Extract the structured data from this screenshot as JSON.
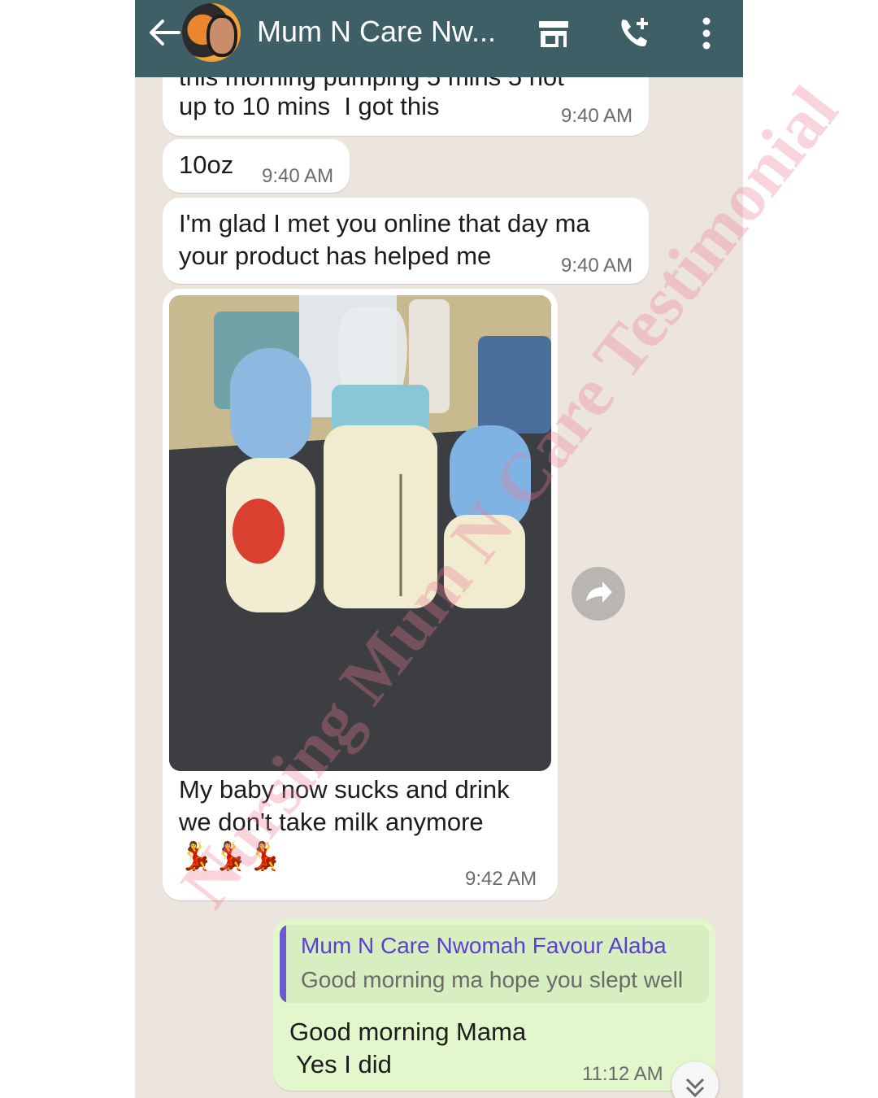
{
  "header": {
    "title": "Mum N Care Nw...",
    "icons": [
      "arrow-back-icon",
      "storefront-icon",
      "add-call-icon",
      "more-vert-icon"
    ],
    "color": "#3f5f66"
  },
  "messages": [
    {
      "text": "this morning pumping 5 mins 5 not",
      "time": ""
    },
    {
      "text": "up to 10 mins  I got this",
      "time": "9:40 AM"
    },
    {
      "text": "10oz",
      "time": "9:40 AM"
    },
    {
      "line1": "I'm glad I met you online that day ma",
      "line2": "your product has helped me",
      "time": "9:40 AM"
    },
    {
      "line1": "My baby now sucks and drink",
      "line2": "we don't take milk anymore",
      "emoji": "💃💃💃",
      "time": "9:42 AM",
      "image_icon": "baby-bottles-photo"
    }
  ],
  "reply": {
    "quoted_name": "Mum N Care Nwomah Favour Alaba",
    "quoted_text": "Good morning ma hope you slept well",
    "line1": "Good morning Mama",
    "line2": " Yes I did",
    "time": "11:12 AM",
    "bubble_color": "#e2f7cb"
  },
  "watermark": "Nursing Mum N Care Testimonial"
}
